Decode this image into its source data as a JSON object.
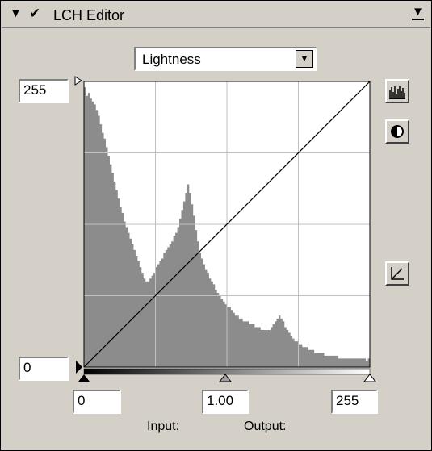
{
  "window": {
    "title": "LCH Editor"
  },
  "channel_select": {
    "value": "Lightness"
  },
  "output_max": {
    "value": "255"
  },
  "output_min": {
    "value": "0"
  },
  "input_black": {
    "value": "0"
  },
  "input_gamma": {
    "value": "1.00"
  },
  "input_white": {
    "value": "255"
  },
  "labels": {
    "input": "Input:",
    "output": "Output:"
  },
  "icons": {
    "collapse": "collapse-arrow-icon",
    "check": "checkmark-icon",
    "menu": "panel-menu-icon",
    "histogram": "histogram-icon",
    "contrast": "contrast-icon",
    "reset_curve": "reset-curve-icon"
  },
  "histogram": {
    "levels": [
      98,
      95,
      96,
      94,
      93,
      92,
      90,
      88,
      85,
      82,
      80,
      77,
      74,
      71,
      68,
      65,
      62,
      59,
      56,
      54,
      51,
      49,
      47,
      45,
      43,
      41,
      39,
      37,
      35,
      33,
      31,
      30,
      30,
      31,
      32,
      33,
      35,
      36,
      37,
      38,
      40,
      41,
      42,
      43,
      44,
      46,
      47,
      49,
      52,
      55,
      58,
      61,
      64,
      61,
      57,
      53,
      48,
      44,
      40,
      38,
      36,
      34,
      33,
      31,
      30,
      29,
      27,
      26,
      25,
      24,
      23,
      22,
      21,
      21,
      20,
      19,
      18,
      18,
      17,
      17,
      16,
      16,
      16,
      15,
      15,
      15,
      14,
      14,
      14,
      13,
      13,
      13,
      13,
      13,
      14,
      15,
      16,
      17,
      18,
      17,
      16,
      14,
      13,
      12,
      11,
      10,
      9,
      9,
      8,
      8,
      7,
      7,
      7,
      6,
      6,
      6,
      5,
      5,
      5,
      5,
      5,
      4,
      4,
      4,
      4,
      4,
      4,
      4,
      3,
      3,
      3,
      3,
      3,
      3,
      3,
      3,
      3,
      3,
      3,
      3,
      3,
      3,
      2,
      3
    ]
  }
}
